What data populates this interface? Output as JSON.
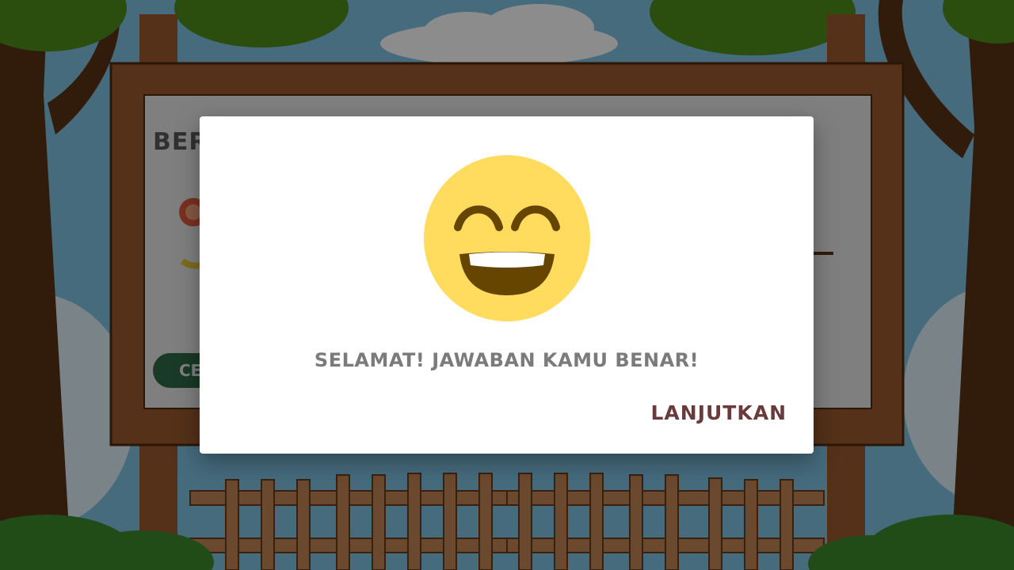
{
  "board": {
    "title_fragment": "BER",
    "button_fragment": "CE"
  },
  "dialog": {
    "emoji_icon": "grinning-face-with-smiling-eyes-icon",
    "message": "SELAMAT! JAWABAN KAMU BENAR!",
    "continue_label": "LANJUTKAN"
  },
  "colors": {
    "emoji_face": "#FFDC5D",
    "emoji_mouth": "#664500",
    "message_text": "#7B7B7B",
    "continue_text": "#6A3B3D"
  }
}
